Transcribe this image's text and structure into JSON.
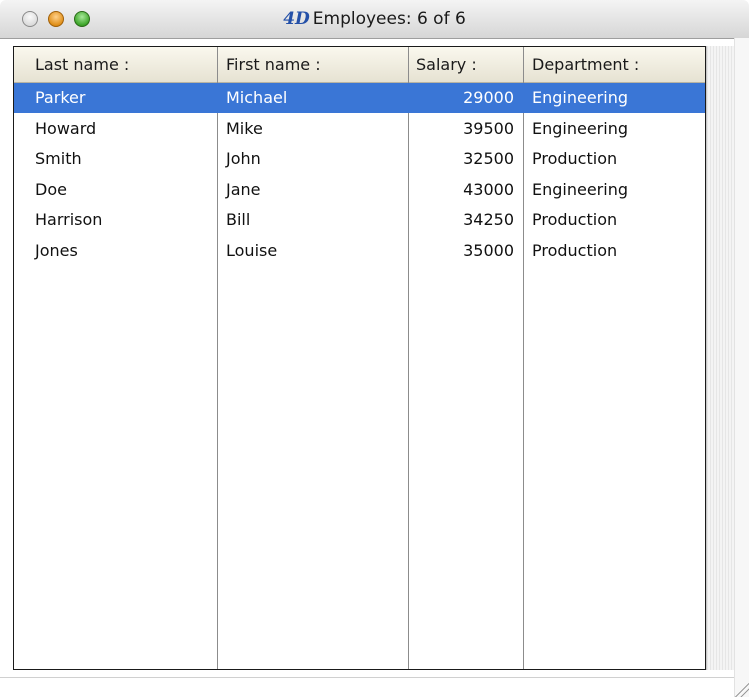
{
  "window": {
    "title_logo": "4D",
    "title": "Employees: 6 of 6"
  },
  "columns": [
    {
      "label": "Last name :"
    },
    {
      "label": "First name :"
    },
    {
      "label": "Salary :"
    },
    {
      "label": "Department :"
    }
  ],
  "rows": [
    {
      "last": "Parker",
      "first": "Michael",
      "salary": "29000",
      "department": "Engineering",
      "selected": true
    },
    {
      "last": "Howard",
      "first": "Mike",
      "salary": "39500",
      "department": "Engineering",
      "selected": false
    },
    {
      "last": "Smith",
      "first": "John",
      "salary": "32500",
      "department": "Production",
      "selected": false
    },
    {
      "last": "Doe",
      "first": "Jane",
      "salary": "43000",
      "department": "Engineering",
      "selected": false
    },
    {
      "last": "Harrison",
      "first": "Bill",
      "salary": "34250",
      "department": "Production",
      "selected": false
    },
    {
      "last": "Jones",
      "first": "Louise",
      "salary": "35000",
      "department": "Production",
      "selected": false
    }
  ],
  "colors": {
    "selection": "#3a76d6",
    "header_bg": "#ece8d8"
  },
  "icons": {
    "close": "close-button-icon",
    "minimize": "minimize-button-icon",
    "zoom": "zoom-button-icon",
    "resize": "resize-grip-icon"
  }
}
